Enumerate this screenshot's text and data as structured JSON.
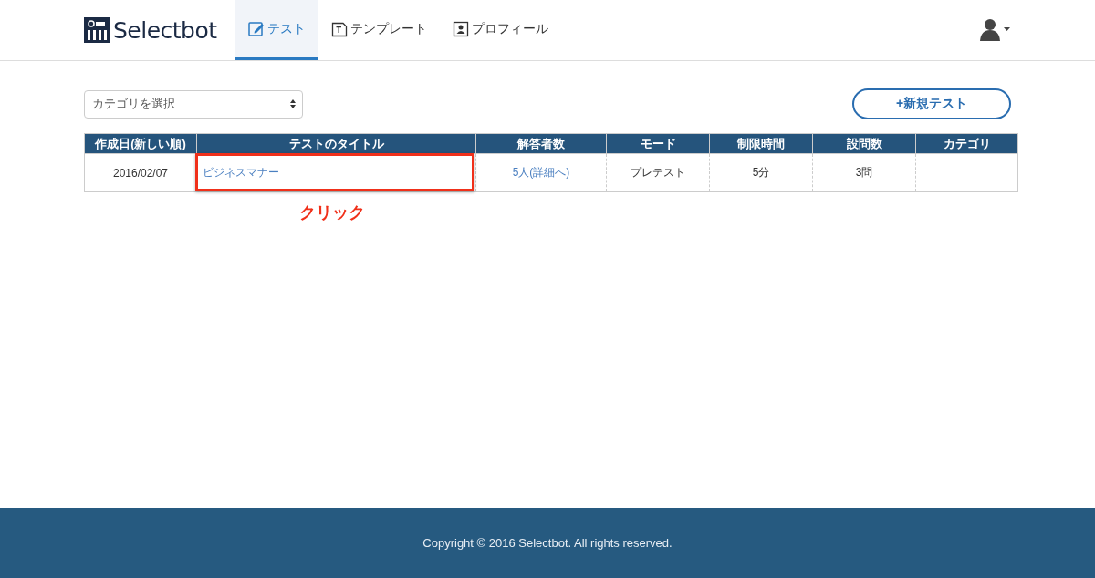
{
  "header": {
    "logo": "Selectbot",
    "tabs": [
      {
        "label": "テスト",
        "kind": "edit",
        "selected": true
      },
      {
        "label": "テンプレート",
        "kind": "template",
        "selected": false
      },
      {
        "label": "プロフィール",
        "kind": "profile",
        "selected": false
      }
    ]
  },
  "toolbar": {
    "category_select": {
      "placeholder": "カテゴリを選択"
    },
    "new_button": "+新規テスト"
  },
  "table": {
    "columns": [
      "作成日(新しい順)",
      "テストのタイトル",
      "解答者数",
      "モード",
      "制限時間",
      "設問数",
      "カテゴリ"
    ],
    "rows": [
      {
        "cells": [
          {
            "text": "2016/02/07",
            "kind": "text"
          },
          {
            "text": "ビジネスマナー",
            "kind": "link"
          },
          {
            "text": "5人(詳細へ)",
            "kind": "link"
          },
          {
            "text": "プレテスト",
            "kind": "text"
          },
          {
            "text": "5分",
            "kind": "text"
          },
          {
            "text": "3問",
            "kind": "text"
          }
        ]
      }
    ]
  },
  "annotation": {
    "label": "クリック"
  },
  "footer": "Copyright © 2016 Selectbot. All rights reserved."
}
